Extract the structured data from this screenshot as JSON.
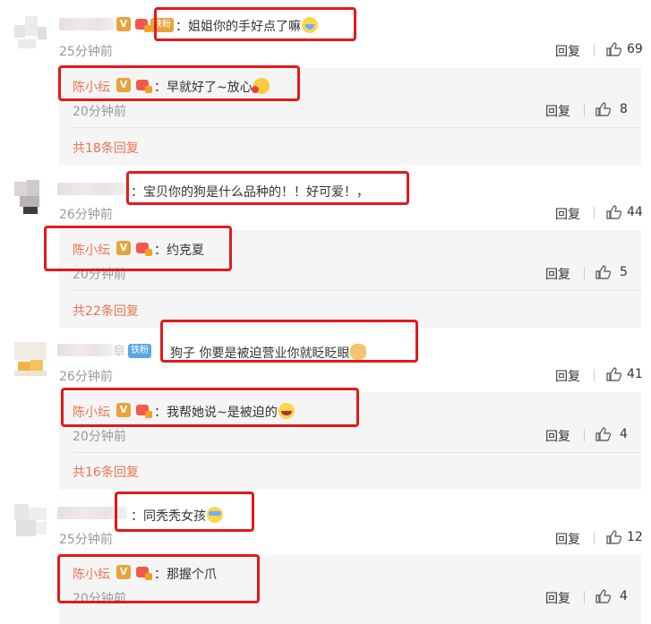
{
  "comments": [
    {
      "text": "：姐姐你的手好点了嘛",
      "fan_tag": "铁粉",
      "emoji": "crying-face",
      "time": "25分钟前",
      "reply": "回复",
      "likes": "69",
      "sub": {
        "name": "陈小纭",
        "text": "：早就好了~放心",
        "emoji": "kiss-face",
        "time": "20分钟前",
        "reply": "回复",
        "likes": "8",
        "more": "共18条回复"
      }
    },
    {
      "text": "：宝贝你的狗是什么品种的！！好可爱！，",
      "time": "26分钟前",
      "reply": "回复",
      "likes": "44",
      "sub": {
        "name": "陈小纭",
        "text": "：约克夏",
        "time": "20分钟前",
        "reply": "回复",
        "likes": "5",
        "more": "共22条回复"
      }
    },
    {
      "name_suffix": "章",
      "fan_tag": "铁粉",
      "text": "狗子 你要是被迫营业你就眨眨眼",
      "emoji": "doge",
      "time": "26分钟前",
      "reply": "回复",
      "likes": "41",
      "sub": {
        "name": "陈小纭",
        "text": "：我帮她说~是被迫的",
        "emoji": "laugh-cry",
        "time": "20分钟前",
        "reply": "回复",
        "likes": "4",
        "more": "共16条回复"
      }
    },
    {
      "text": "：同秃秃女孩",
      "emoji": "tearful-face",
      "time": "25分钟前",
      "reply": "回复",
      "likes": "12",
      "sub": {
        "name": "陈小纭",
        "text": "：那握个爪",
        "time": "20分钟前",
        "reply": "回复",
        "likes": "4"
      }
    }
  ],
  "colors": {
    "highlight": "#e21a1a",
    "reply_name": "#eb7350",
    "verified_badge": "#e8a33a",
    "sub_bg": "#f5f5f5"
  },
  "icons": [
    "thumbs-up-icon",
    "verified-v-icon",
    "member-badge-icon"
  ]
}
